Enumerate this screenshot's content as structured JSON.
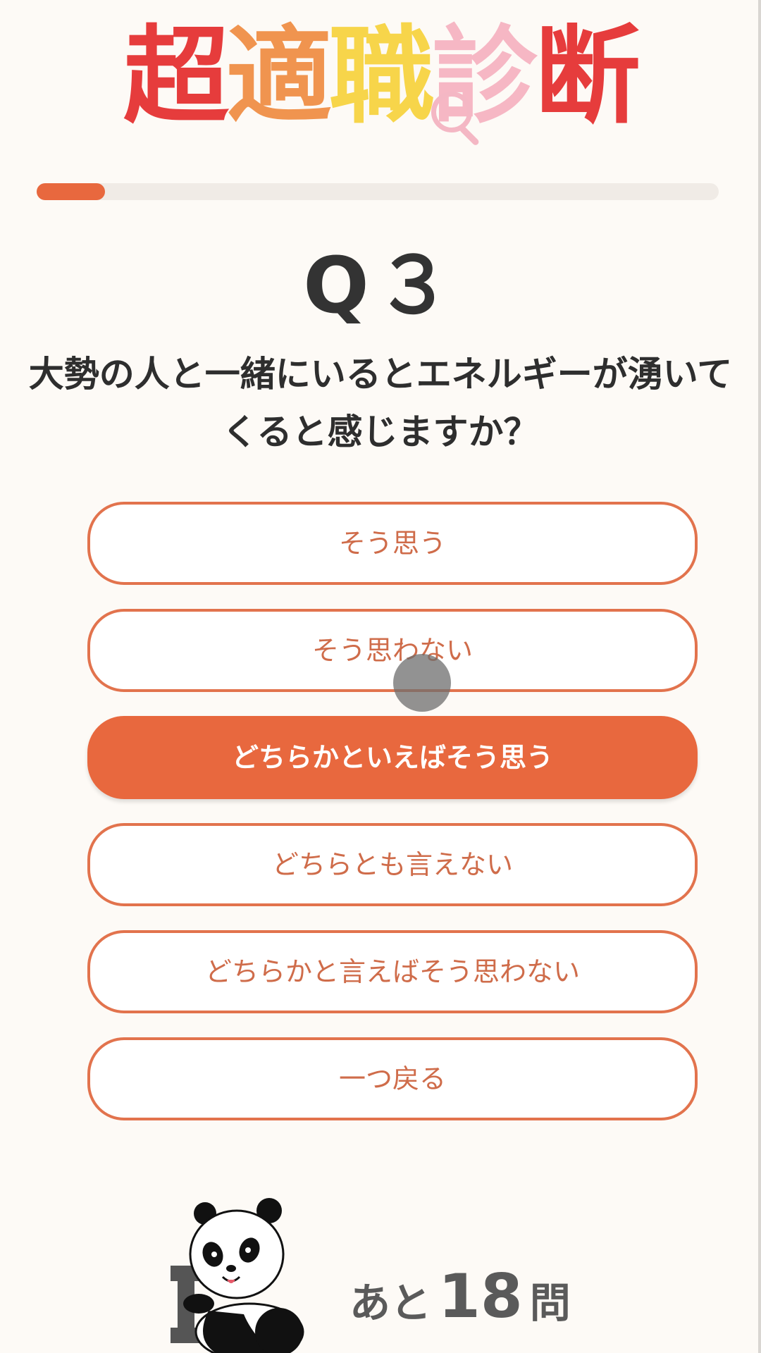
{
  "logo": {
    "chars": [
      {
        "text": "超",
        "color": "#e63c3c"
      },
      {
        "text": "適",
        "color": "#f0944f"
      },
      {
        "text": "職",
        "color": "#f7d54a"
      },
      {
        "text": "診",
        "color": "#f6b7c4"
      },
      {
        "text": "断",
        "color": "#e63c3c"
      }
    ]
  },
  "progress": {
    "fraction": 0.1
  },
  "question": {
    "number": "Q３",
    "text": "大勢の人と一緒にいるとエネルギーが湧いてくると感じますか？"
  },
  "options": [
    {
      "label": "そう思う"
    },
    {
      "label": "そう思わない"
    },
    {
      "label": "どちらかといえばそう思う"
    },
    {
      "label": "どちらとも言えない"
    },
    {
      "label": "どちらかと言えばそう思わない"
    },
    {
      "label": "一つ戻る"
    }
  ],
  "remaining": {
    "prefix": "あと",
    "count": "18",
    "suffix": "問"
  },
  "colors": {
    "accent": "#e8683e",
    "background": "#fdfaf6"
  }
}
